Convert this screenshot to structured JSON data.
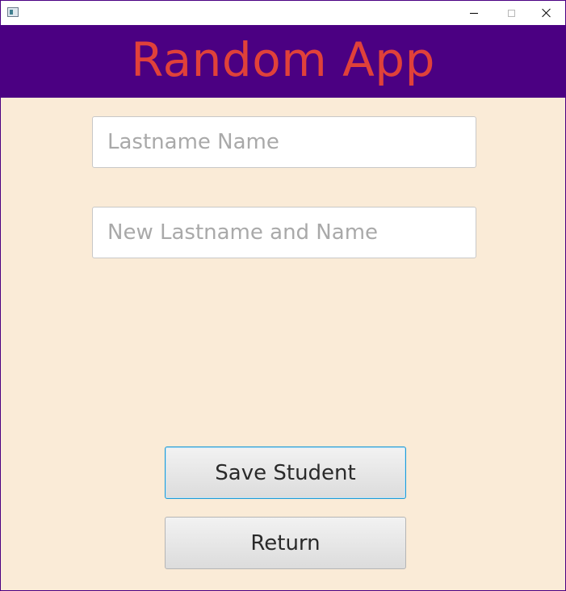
{
  "window": {
    "icon": "app-window-icon",
    "controls": {
      "minimize_icon": "minimize-icon",
      "maximize_icon": "maximize-icon",
      "close_icon": "close-icon"
    }
  },
  "header": {
    "title": "Random App"
  },
  "form": {
    "lastname_field": {
      "placeholder": "Lastname Name",
      "value": ""
    },
    "new_name_field": {
      "placeholder": "New Lastname and Name",
      "value": ""
    }
  },
  "buttons": {
    "save_label": "Save Student",
    "return_label": "Return"
  },
  "colors": {
    "header_bg": "#4b0082",
    "title_color": "#e0413a",
    "content_bg": "#faebd7",
    "focus_border": "#1e9ad6"
  }
}
